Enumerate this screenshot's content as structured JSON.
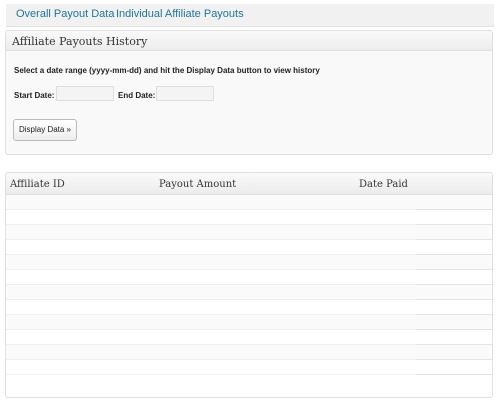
{
  "tabs": [
    {
      "label": "Overall Payout Data"
    },
    {
      "label": "Individual Affiliate Payouts"
    }
  ],
  "history_box": {
    "title": "Affiliate Payouts History",
    "instructions": "Select a date range (yyyy-mm-dd) and hit the Display Data button to view history",
    "start_label": "Start Date:",
    "start_value": "",
    "end_label": "End Date:",
    "end_value": "",
    "button_label": "Display Data »"
  },
  "table": {
    "columns": [
      "Affiliate ID",
      "Payout Amount",
      "Date Paid"
    ],
    "rows": [
      [
        "",
        "",
        ""
      ],
      [
        "",
        "",
        ""
      ],
      [
        "",
        "",
        ""
      ],
      [
        "",
        "",
        ""
      ],
      [
        "",
        "",
        ""
      ],
      [
        "",
        "",
        ""
      ],
      [
        "",
        "",
        ""
      ],
      [
        "",
        "",
        ""
      ],
      [
        "",
        "",
        ""
      ],
      [
        "",
        "",
        ""
      ],
      [
        "",
        "",
        ""
      ],
      [
        "",
        "",
        ""
      ]
    ]
  }
}
